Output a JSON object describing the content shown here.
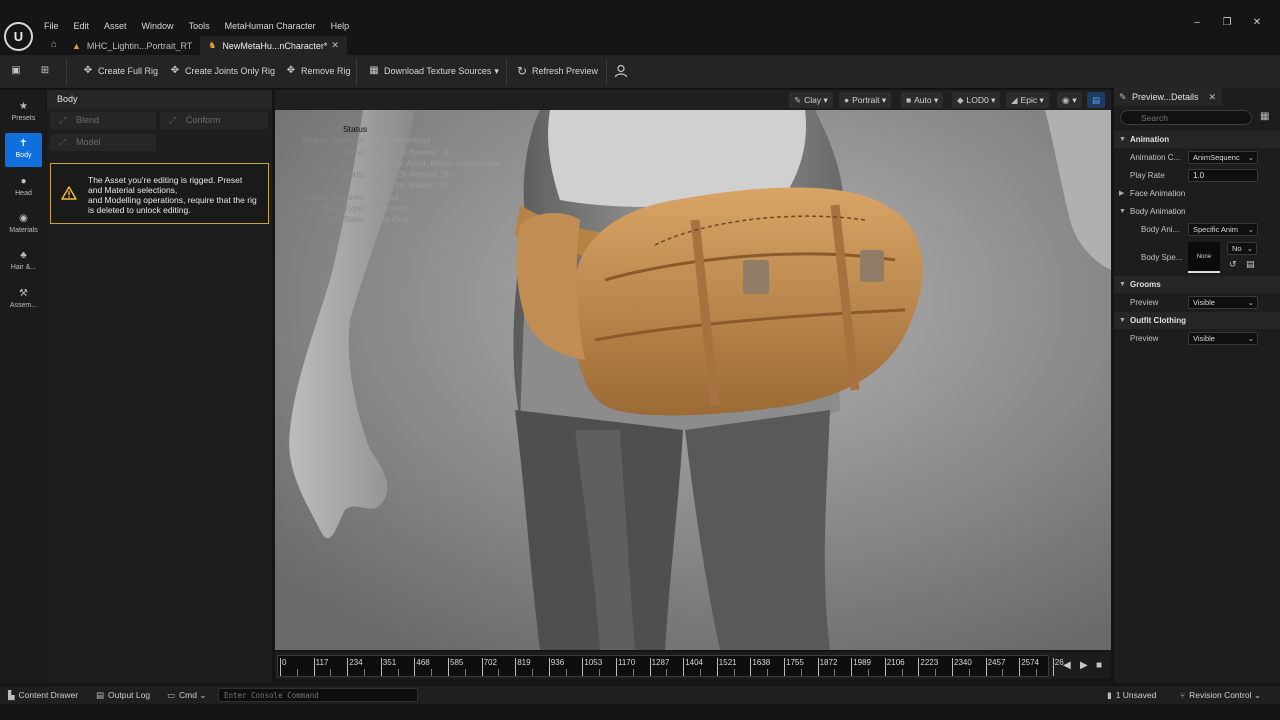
{
  "menu": {
    "logo": "U",
    "items": [
      "File",
      "Edit",
      "Asset",
      "Window",
      "Tools",
      "MetaHuman Character",
      "Help"
    ]
  },
  "window_controls": {
    "minimize": "–",
    "restore": "❐",
    "close": "✕"
  },
  "tabs": [
    {
      "label": "MHC_Lightin...Portrait_RT",
      "icon": "level-icon",
      "active": false
    },
    {
      "label": "NewMetaHu...nCharacter*",
      "icon": "character-icon",
      "active": true
    }
  ],
  "toolbar": {
    "create_full_rig": "Create Full Rig",
    "create_joints_only_rig": "Create Joints Only Rig",
    "remove_rig": "Remove Rig",
    "download_texture_sources": "Download Texture Sources",
    "download_arrow": "▾",
    "refresh_preview": "Refresh Preview"
  },
  "rail": [
    {
      "label": "Presets",
      "icon": "star-icon",
      "active": false
    },
    {
      "label": "Body",
      "icon": "body-icon",
      "active": true
    },
    {
      "label": "Head",
      "icon": "head-icon",
      "active": false
    },
    {
      "label": "Materials",
      "icon": "materials-icon",
      "active": false
    },
    {
      "label": "Hair &...",
      "icon": "hair-icon",
      "active": false
    },
    {
      "label": "Assem...",
      "icon": "hammer-icon",
      "active": false
    }
  ],
  "panel": {
    "title": "Body",
    "blend": "Blend",
    "conform": "Conform",
    "model": "Model",
    "warning_lines": [
      "The Asset you're editing is rigged. Preset",
      "and Material selections,",
      "and Modelling operations, require that the rig",
      "is deleted to unlock editing."
    ]
  },
  "viewport_toolbar": {
    "clay": "Clay",
    "portrait": "Portrait",
    "auto": "Auto",
    "lod": "LOD0",
    "epic": "Epic",
    "arrow": "▾"
  },
  "status": {
    "title": "Status",
    "rows": [
      {
        "k": "Texture Sources:",
        "v": "Needs download"
      },
      {
        "k": "Face:",
        "v": "Albedo: 1k Normal: 1k"
      },
      {
        "k": "",
        "v": "Cavity 1k: Anim. Maps: Unavailable"
      },
      {
        "k": "Body:",
        "v": "Albedo: 2k Normal: 2k"
      },
      {
        "k": "",
        "v": "Cavity: 2k, Masks: 1k"
      },
      {
        "k": "Virtual Textures:",
        "v": "Enabled"
      },
      {
        "k": "Body Type:",
        "v": "Parametric"
      },
      {
        "k": "Rig State:",
        "v": "Joints Only"
      }
    ]
  },
  "timeline": {
    "ticks": [
      "0",
      "117",
      "234",
      "351",
      "468",
      "585",
      "702",
      "819",
      "936",
      "1053",
      "1170",
      "1287",
      "1404",
      "1521",
      "1638",
      "1755",
      "1872",
      "1989",
      "2106",
      "2223",
      "2340",
      "2457",
      "2574",
      "26"
    ]
  },
  "details": {
    "tab": "Preview...Details",
    "search_placeholder": "Search",
    "animation": "Animation",
    "animation_class_label": "Animation C...",
    "animation_class_value": "AnimSequenc",
    "play_rate_label": "Play Rate",
    "play_rate_value": "1.0",
    "face_animation": "Face Animation",
    "body_animation": "Body Animation",
    "body_ani_label": "Body Ani...",
    "body_ani_value": "Specific Anim",
    "body_spe_label": "Body Spe...",
    "body_spe_value": "No",
    "thumb_label": "None",
    "grooms": "Grooms",
    "grooms_preview_label": "Preview",
    "grooms_preview_value": "Visible",
    "outfit_clothing": "Outfit Clothing",
    "outfit_preview_label": "Preview",
    "outfit_preview_value": "Visible"
  },
  "statusbar": {
    "content_drawer": "Content Drawer",
    "output_log": "Output Log",
    "cmd": "Cmd",
    "console_placeholder": "Enter Console Command",
    "unsaved": "1 Unsaved",
    "revision_control": "Revision Control"
  },
  "colors": {
    "accent": "#0f6fdc",
    "warning": "#c7a33a",
    "bag": "#c8914f"
  }
}
